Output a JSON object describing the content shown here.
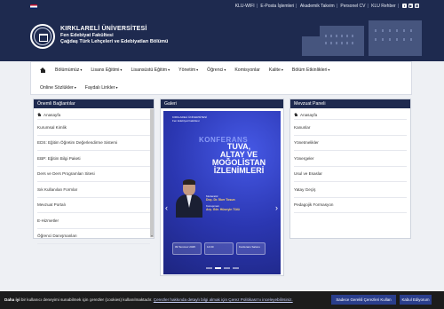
{
  "topbar": {
    "links": [
      "KLU-WIFI",
      "E-Posta İşlemleri",
      "Akademik Takvim",
      "Personel CV",
      "KLU Rehber"
    ]
  },
  "header": {
    "university": "KIRKLARELİ ÜNİVERSİTESİ",
    "faculty": "Fen Edebiyat Fakültesi",
    "department": "Çağdaş Türk Lehçeleri ve Edebiyatları Bölümü"
  },
  "nav": {
    "row1": [
      "Bölümümüz",
      "Lisans Eğitimi",
      "Lisansüstü Eğitim",
      "Yönetim",
      "Öğrenci",
      "Komisyonlar",
      "Kalite",
      "Bölüm Etkinlikleri"
    ],
    "row1_has_caret": [
      true,
      true,
      true,
      true,
      true,
      false,
      true,
      true
    ],
    "row2": [
      "Online Sözlükler",
      "Faydalı Linkler"
    ]
  },
  "left_panel": {
    "title": "Önemli Bağlantılar",
    "items": [
      "Anasayfa",
      "Kurumsal Kimlik",
      "EDS: Eğitim Öğretim Değerlendirme Sistemi",
      "EBP: Eğitim Bilgi Paketi",
      "Ders ve Ders Programları Sitesi",
      "Sık Kullanılan Formlar",
      "Mevzuat Portalı",
      "E-Hizmetler",
      "Öğrenci Danışmanları"
    ]
  },
  "gallery": {
    "title": "Galeri",
    "poster": {
      "org_lines": [
        "KIRKLARELİ ÜNİVERSİTESİ",
        "Fen Edebiyat Fakültesi"
      ],
      "konferans": "KONFERANS",
      "headline": [
        "TUVA,",
        "ALTAY VE",
        "MOĞOLİSTAN",
        "İZLENİMLERİ"
      ],
      "moderator_label": "Moderatör",
      "moderator_name": "Doç. Dr. İlker Tosun",
      "speaker_label": "Konuşmacı",
      "speaker_name": "Arş. Gör. Hüseyin Tülü",
      "chips": [
        "09 Temmuz 2025",
        "14:00",
        "Konferans Salonu"
      ]
    }
  },
  "right_panel": {
    "title": "Mevzuat Paneli",
    "items": [
      "Anasayfa",
      "Kanunlar",
      "Yönetmelikler",
      "Yönergeler",
      "Usul ve Esaslar",
      "Yatay Geçiş",
      "Pedagojik Formasyon"
    ]
  },
  "cookie": {
    "lead": "Daha iyi",
    "text": " bir kullanıcı deneyimi sunabilmek için çerezler (cookies) kullanılmaktadır.",
    "link": "Çerezler hakkında detaylı bilgi almak için Çerez Politikası'nı inceleyebilirsiniz.",
    "btn_necessary": "Sadece Gerekli Çerezleri Kullan",
    "btn_accept": "Kabul Ediyorum"
  },
  "colors": {
    "primary": "#1e2a4f",
    "poster": "#2e3db8",
    "cookie_bg": "#1c1c1c",
    "button": "#2a3e8c"
  }
}
